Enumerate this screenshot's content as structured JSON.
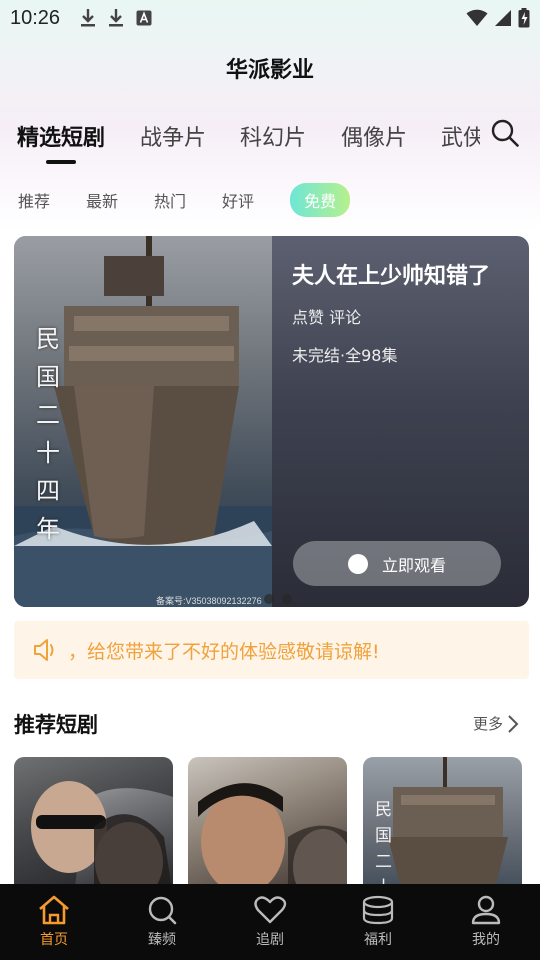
{
  "status_bar": {
    "time": "10:26",
    "left_icons": [
      "download-icon",
      "download-icon",
      "font-icon"
    ],
    "right_icons": [
      "wifi-icon",
      "signal-icon",
      "battery-charging-icon"
    ]
  },
  "app_title": "华派影业",
  "category_tabs": [
    {
      "label": "精选短剧",
      "active": true
    },
    {
      "label": "战争片",
      "active": false
    },
    {
      "label": "科幻片",
      "active": false
    },
    {
      "label": "偶像片",
      "active": false
    },
    {
      "label": "武侠",
      "active": false
    }
  ],
  "sub_tabs": [
    {
      "label": "推荐",
      "active": false
    },
    {
      "label": "最新",
      "active": false
    },
    {
      "label": "热门",
      "active": false
    },
    {
      "label": "好评",
      "active": false
    },
    {
      "label": "免费",
      "active": true
    }
  ],
  "banner": {
    "poster_text": "民国二十四年",
    "poster_reg": "备案号:V35038092132276",
    "title": "夫人在上少帅知错了",
    "actions": "点赞 评论",
    "status": "未完结·全98集",
    "watch_label": "立即观看",
    "pager": {
      "count": 2,
      "current": 1
    }
  },
  "notice": {
    "text": "，给您带来了不好的体验感敬请谅解!",
    "color": "#f0a23c"
  },
  "recommended": {
    "title": "推荐短剧",
    "more_label": "更多",
    "cards": [
      {
        "type": "poster"
      },
      {
        "type": "poster"
      },
      {
        "type": "poster",
        "text": "民国二十"
      }
    ]
  },
  "bottom_nav": [
    {
      "label": "首页",
      "icon": "home-icon",
      "active": true
    },
    {
      "label": "臻频",
      "icon": "search-icon",
      "active": false
    },
    {
      "label": "追剧",
      "icon": "heart-icon",
      "active": false
    },
    {
      "label": "福利",
      "icon": "coins-icon",
      "active": false
    },
    {
      "label": "我的",
      "icon": "user-icon",
      "active": false
    }
  ],
  "colors": {
    "accent": "#f59a2f",
    "nav_background": "#0b0b0b",
    "free_tab_gradient": [
      "#6ee6d6",
      "#b7f08c"
    ]
  }
}
